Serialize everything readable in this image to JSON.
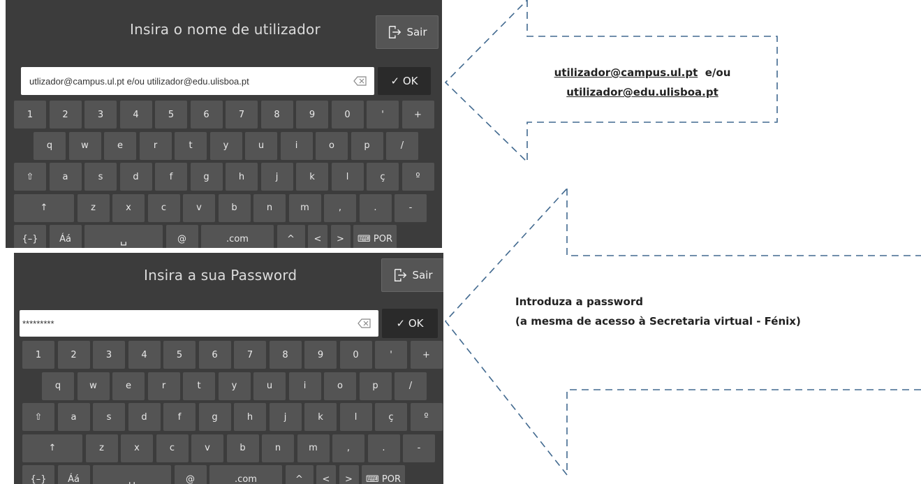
{
  "top_panel": {
    "title": "Insira o nome de utilizador",
    "sair_label": "Sair",
    "input_value": "utlizador@campus.ul.pt e/ou utilizador@edu.ulisboa.pt",
    "ok_label": "✓ OK"
  },
  "bottom_panel": {
    "title": "Insira a sua Password",
    "sair_label": "Sair",
    "input_value": "*********",
    "ok_label": "✓ OK"
  },
  "keyboard": {
    "rows": [
      [
        "1",
        "2",
        "3",
        "4",
        "5",
        "6",
        "7",
        "8",
        "9",
        "0",
        "'",
        "+"
      ],
      [
        "q",
        "w",
        "e",
        "r",
        "t",
        "y",
        "u",
        "i",
        "o",
        "p",
        "/"
      ],
      [
        "⇧",
        "a",
        "s",
        "d",
        "f",
        "g",
        "h",
        "j",
        "k",
        "l",
        "ç",
        "º"
      ],
      [
        "↑",
        "z",
        "x",
        "c",
        "v",
        "b",
        "n",
        "m",
        ",",
        ".",
        "-"
      ],
      [
        "{–}",
        "Áá",
        "␣",
        "@",
        ".com",
        "^",
        "<",
        ">",
        "⌨ POR"
      ]
    ]
  },
  "callout_1": {
    "email_a": "utilizador@campus.ul.pt",
    "connector": "e/ou",
    "email_b": "utilizador@edu.ulisboa.pt"
  },
  "callout_2": {
    "line1": "Introduza a password",
    "line2": "(a mesma de acesso à Secretaria virtual - Fénix)"
  },
  "colors": {
    "panel_bg": "#3c3c3c",
    "key_bg": "#545454",
    "ok_bg": "#2a2a2a",
    "callout_stroke": "#41698f"
  },
  "icons": [
    "exit-icon",
    "clear-text-icon",
    "check-icon",
    "keyboard-icon"
  ]
}
